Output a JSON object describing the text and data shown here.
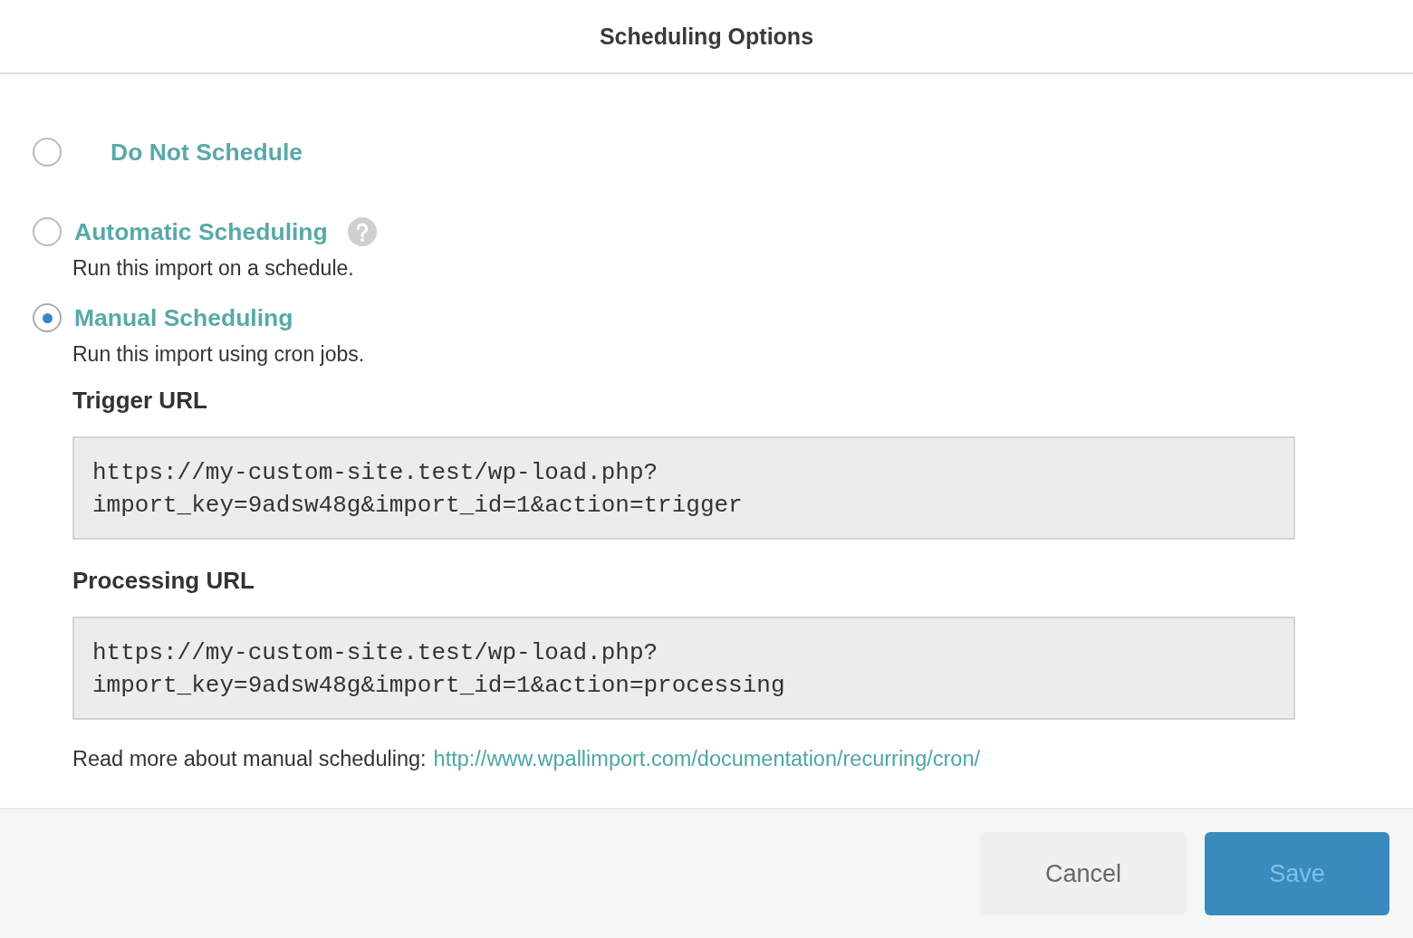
{
  "dialog": {
    "title": "Scheduling Options"
  },
  "options": [
    {
      "label": "Do Not Schedule",
      "selected": false,
      "help": false
    },
    {
      "label": "Automatic Scheduling",
      "selected": false,
      "help": true,
      "description": "Run this import on a schedule."
    },
    {
      "label": "Manual Scheduling",
      "selected": true,
      "help": false,
      "description": "Run this import using cron jobs."
    }
  ],
  "url_fields": [
    {
      "label": "Trigger URL",
      "value": "https://my-custom-site.test/wp-load.php?\nimport_key=9adsw48g&import_id=1&action=trigger"
    },
    {
      "label": "Processing URL",
      "value": "https://my-custom-site.test/wp-load.php?\nimport_key=9adsw48g&import_id=1&action=processing"
    }
  ],
  "read_more": {
    "text": "Read more about manual scheduling:",
    "link": "http://www.wpallimport.com/documentation/recurring/cron/"
  },
  "buttons": [
    {
      "label": "Cancel",
      "kind": "secondary",
      "disabled": false
    },
    {
      "label": "Save",
      "kind": "primary",
      "disabled": true
    }
  ]
}
